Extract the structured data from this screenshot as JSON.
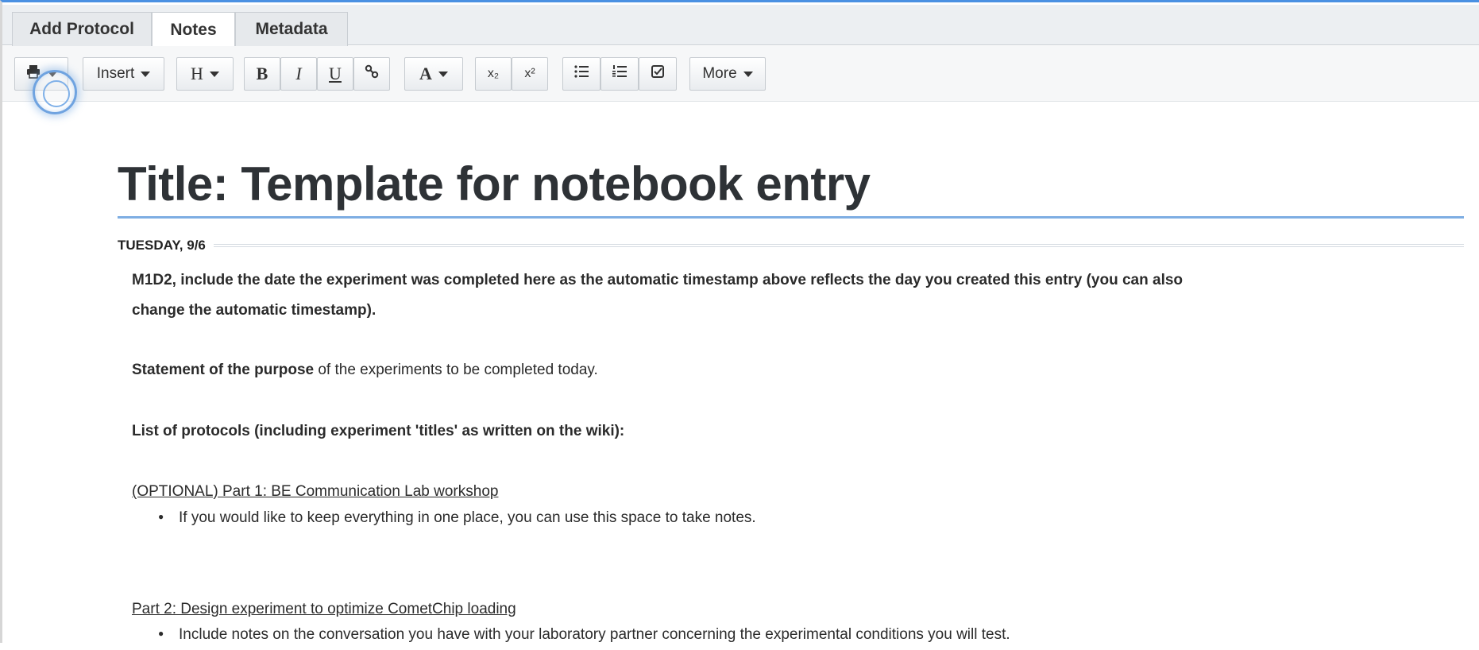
{
  "tabs": {
    "add_protocol": "Add Protocol",
    "notes": "Notes",
    "metadata": "Metadata",
    "active": "Notes"
  },
  "toolbar": {
    "print_icon": "printer-icon",
    "insert_label": "Insert",
    "heading_label": "H",
    "bold_label": "B",
    "italic_label": "I",
    "underline_label": "U",
    "link_label": "%",
    "color_label": "A",
    "subscript_label": "x₂",
    "superscript_label": "x²",
    "bullet_list_label": "☰",
    "numbered_list_label": "☷",
    "checklist_label": "☑",
    "more_label": "More"
  },
  "entry": {
    "title": "Title: Template for notebook entry",
    "date": "TUESDAY, 9/6",
    "paragraphs": {
      "timestamp_note_line1": "M1D2, include the date the experiment was completed here as the automatic timestamp above reflects the day you created this entry (you can also",
      "timestamp_note_line2": "change the automatic timestamp).",
      "purpose_bold": "Statement of the purpose",
      "purpose_rest": " of the experiments to be completed today.",
      "protocols_list": "List of protocols (including experiment 'titles' as written on the wiki):",
      "part1_heading": "(OPTIONAL) Part 1: BE Communication Lab workshop",
      "part1_bullet": "If you would like to keep everything in one place, you can use this space to take notes.",
      "part2_heading": "Part 2: Design experiment to optimize CometChip loading",
      "part2_bullet": "Include notes on the conversation you have with your laboratory partner concerning the experimental conditions you will test."
    }
  },
  "colors": {
    "accent": "#4a90e2",
    "title_underline": "#7eaee3",
    "tabbar_bg": "#eceff2"
  }
}
